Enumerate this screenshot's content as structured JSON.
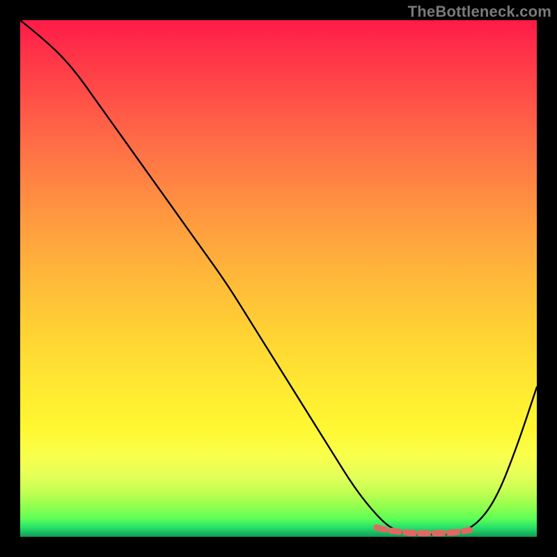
{
  "attribution": "TheBottleneck.com",
  "chart_data": {
    "type": "line",
    "title": "",
    "xlabel": "",
    "ylabel": "",
    "xlim": [
      0,
      100
    ],
    "ylim": [
      0,
      100
    ],
    "series": [
      {
        "name": "curve",
        "color": "#000000",
        "x": [
          0,
          5,
          10,
          15,
          20,
          25,
          30,
          35,
          40,
          45,
          50,
          55,
          60,
          65,
          70,
          73,
          76,
          80,
          84,
          88,
          92,
          96,
          100
        ],
        "values": [
          100,
          96,
          91,
          84,
          77,
          70,
          63,
          56,
          49,
          41,
          33,
          25,
          17,
          9,
          3,
          1,
          0.5,
          0.5,
          0.5,
          2,
          7,
          17,
          29
        ]
      },
      {
        "name": "bottom-markers",
        "color": "#e06862",
        "x": [
          69,
          71,
          73,
          76,
          78,
          81,
          84,
          87
        ],
        "values": [
          1.8,
          1.3,
          1.0,
          0.7,
          0.7,
          0.7,
          0.8,
          1.3
        ]
      }
    ],
    "gradient_stops": [
      {
        "pct": 0,
        "color": "#ff1a47"
      },
      {
        "pct": 6,
        "color": "#ff3148"
      },
      {
        "pct": 18,
        "color": "#ff5a48"
      },
      {
        "pct": 28,
        "color": "#ff7a45"
      },
      {
        "pct": 38,
        "color": "#ff9840"
      },
      {
        "pct": 49,
        "color": "#ffb63a"
      },
      {
        "pct": 60,
        "color": "#ffd134"
      },
      {
        "pct": 70,
        "color": "#ffe732"
      },
      {
        "pct": 79,
        "color": "#fff732"
      },
      {
        "pct": 84,
        "color": "#faff4a"
      },
      {
        "pct": 88,
        "color": "#e6ff59"
      },
      {
        "pct": 91,
        "color": "#c7ff53"
      },
      {
        "pct": 94,
        "color": "#94ff4e"
      },
      {
        "pct": 96.5,
        "color": "#5dff57"
      },
      {
        "pct": 98.2,
        "color": "#27e06a"
      },
      {
        "pct": 99.3,
        "color": "#18b760"
      },
      {
        "pct": 100,
        "color": "#129a55"
      }
    ]
  }
}
